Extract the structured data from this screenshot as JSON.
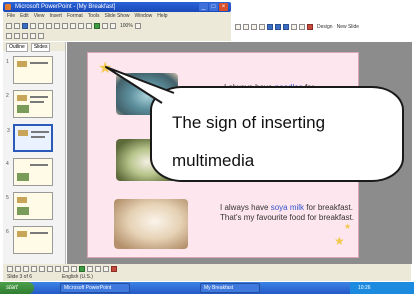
{
  "window": {
    "title": "Microsoft PowerPoint - [My Breakfast]",
    "min": "_",
    "max": "□",
    "close": "×"
  },
  "menubar": [
    "File",
    "Edit",
    "View",
    "Insert",
    "Format",
    "Tools",
    "Slide Show",
    "Window",
    "Help"
  ],
  "toolbar": {
    "zoom": "100%",
    "design": "Design",
    "new_slide": "New Slide"
  },
  "panel": {
    "tabs": [
      "Outline",
      "Slides"
    ],
    "slide_numbers": [
      "1",
      "2",
      "3",
      "4",
      "5",
      "6"
    ]
  },
  "slide": {
    "line1_pre": "I always have ",
    "line1_hl": "noodles",
    "line1_post": " for",
    "para_pre": "I always have ",
    "para_hl": "soya milk",
    "para_post": " for breakfast. That's my favourite food for breakfast."
  },
  "callout": {
    "line1": "The sign of inserting",
    "line2": "multimedia"
  },
  "statusbar": {
    "slide": "Slide 3 of 6",
    "language": "English (U.S.)"
  },
  "taskbar": {
    "start": "start",
    "items": [
      "Microsoft PowerPoint",
      "My Breakfast"
    ],
    "clock": "10:26"
  }
}
